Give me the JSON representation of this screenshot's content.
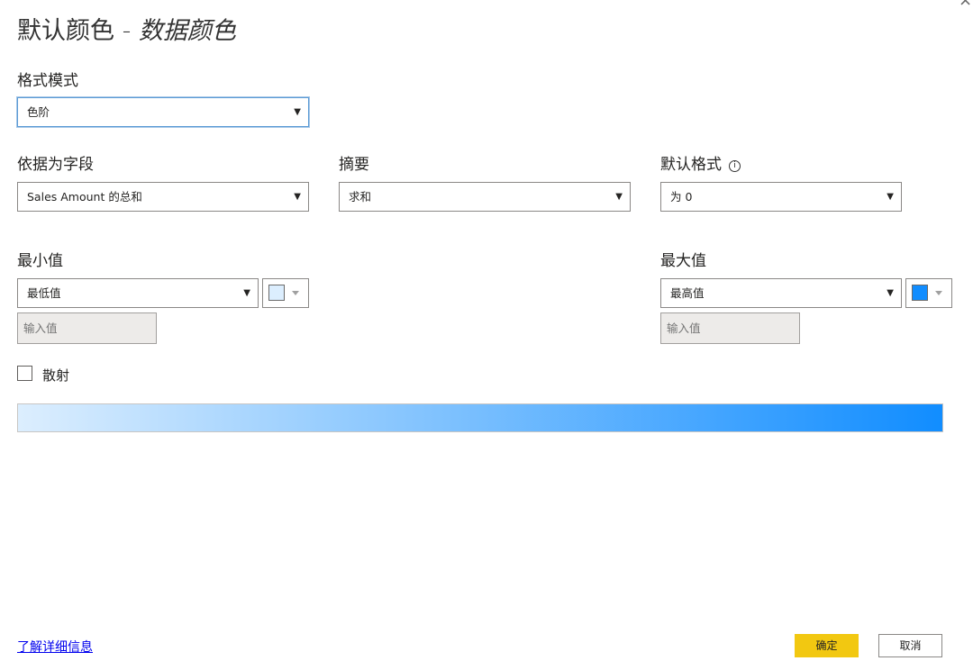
{
  "dialog": {
    "title_main": "默认颜色 - ",
    "title_sub": "数据颜色",
    "close_glyph": "×"
  },
  "format_mode": {
    "label": "格式模式",
    "value": "色阶"
  },
  "based_on_field": {
    "label": "依据为字段",
    "value": "Sales Amount 的总和"
  },
  "summary": {
    "label": "摘要",
    "value": "求和"
  },
  "default_format": {
    "label": "默认格式",
    "info_glyph": "i",
    "value": "为 0"
  },
  "minimum": {
    "label": "最小值",
    "value": "最低值",
    "input_placeholder": "输入值",
    "color": "#dceefe"
  },
  "maximum": {
    "label": "最大值",
    "value": "最高值",
    "input_placeholder": "输入值",
    "color": "#118dff"
  },
  "diverging": {
    "label": "散射",
    "checked": false
  },
  "icons": {
    "dropdown": "▼",
    "info": "info-circle-icon",
    "close": "close-icon"
  },
  "footer": {
    "learn_more": "了解详细信息",
    "ok": "确定",
    "cancel": "取消"
  }
}
